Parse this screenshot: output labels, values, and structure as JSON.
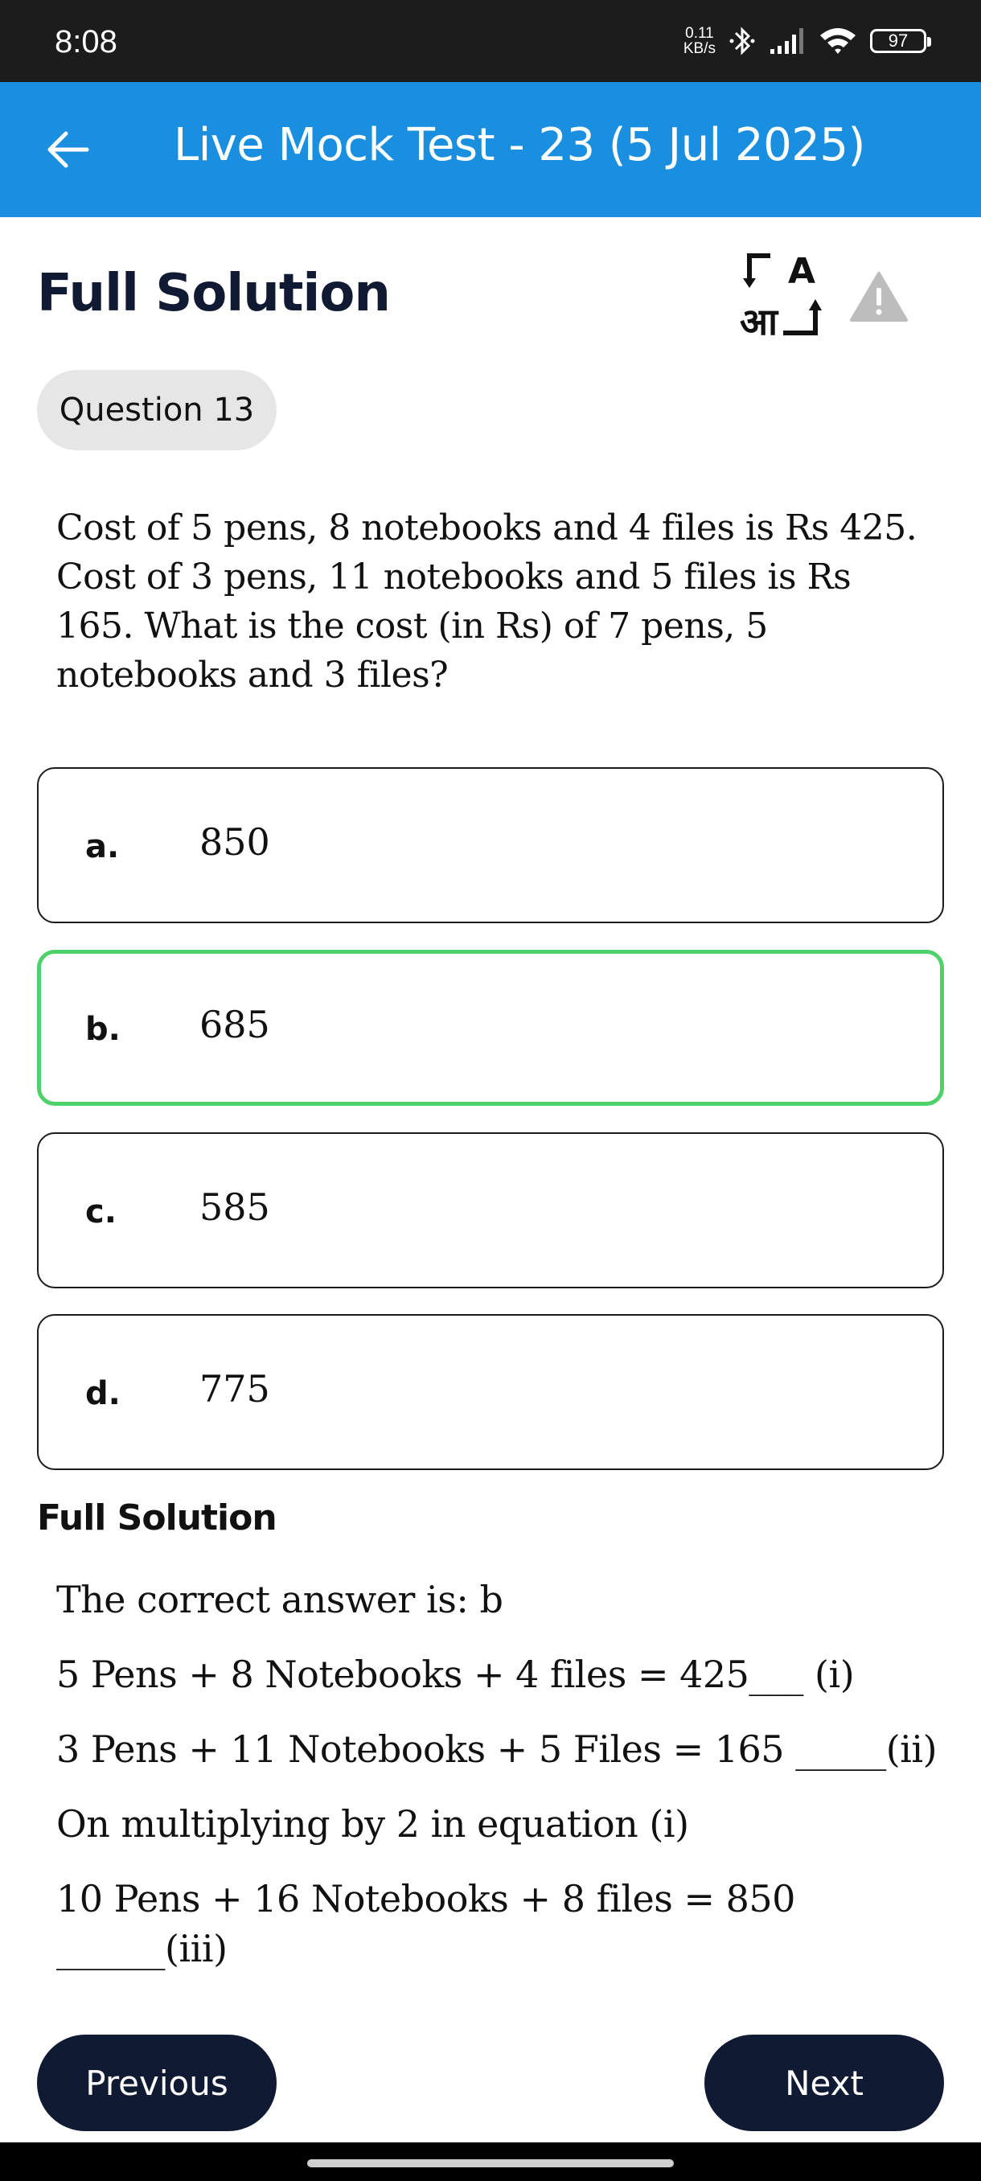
{
  "status_bar": {
    "time": "8:08",
    "net_speed_value": "0.11",
    "net_speed_unit": "KB/s",
    "battery": "97"
  },
  "app_bar": {
    "title": "Live Mock Test - 23 (5 Jul 2025)",
    "back_icon": "arrow-left-icon",
    "color": "#1a8fe0"
  },
  "header": {
    "title": "Full Solution",
    "translate_icon": "translate-icon",
    "report_icon": "warning-triangle-icon"
  },
  "question": {
    "number_label": "Question 13",
    "text_lines": [
      "Cost of 5 pens, 8 notebooks and 4 files is Rs 425.",
      "Cost of 3 pens, 11 notebooks and 5 files is Rs",
      "165. What is the cost (in Rs) of 7 pens, 5",
      "notebooks and 3 files?"
    ]
  },
  "options": [
    {
      "letter": "a.",
      "value": "850",
      "correct": false
    },
    {
      "letter": "b.",
      "value": "685",
      "correct": true
    },
    {
      "letter": "c.",
      "value": "585",
      "correct": false
    },
    {
      "letter": "d.",
      "value": "775",
      "correct": false
    }
  ],
  "solution": {
    "heading": "Full Solution",
    "lines": [
      "The correct answer is: b",
      "5 Pens + 8 Notebooks + 4 files = 425___ (i)",
      "3 Pens + 11 Notebooks + 5 Files = 165 _____(ii)",
      "On multiplying by 2 in equation (i)",
      "10 Pens + 16 Notebooks + 8 files = 850",
      "______(iii)"
    ]
  },
  "nav": {
    "previous_label": "Previous",
    "next_label": "Next"
  },
  "colors": {
    "correct_border": "#4fd16a",
    "dark_button": "#101a33"
  }
}
